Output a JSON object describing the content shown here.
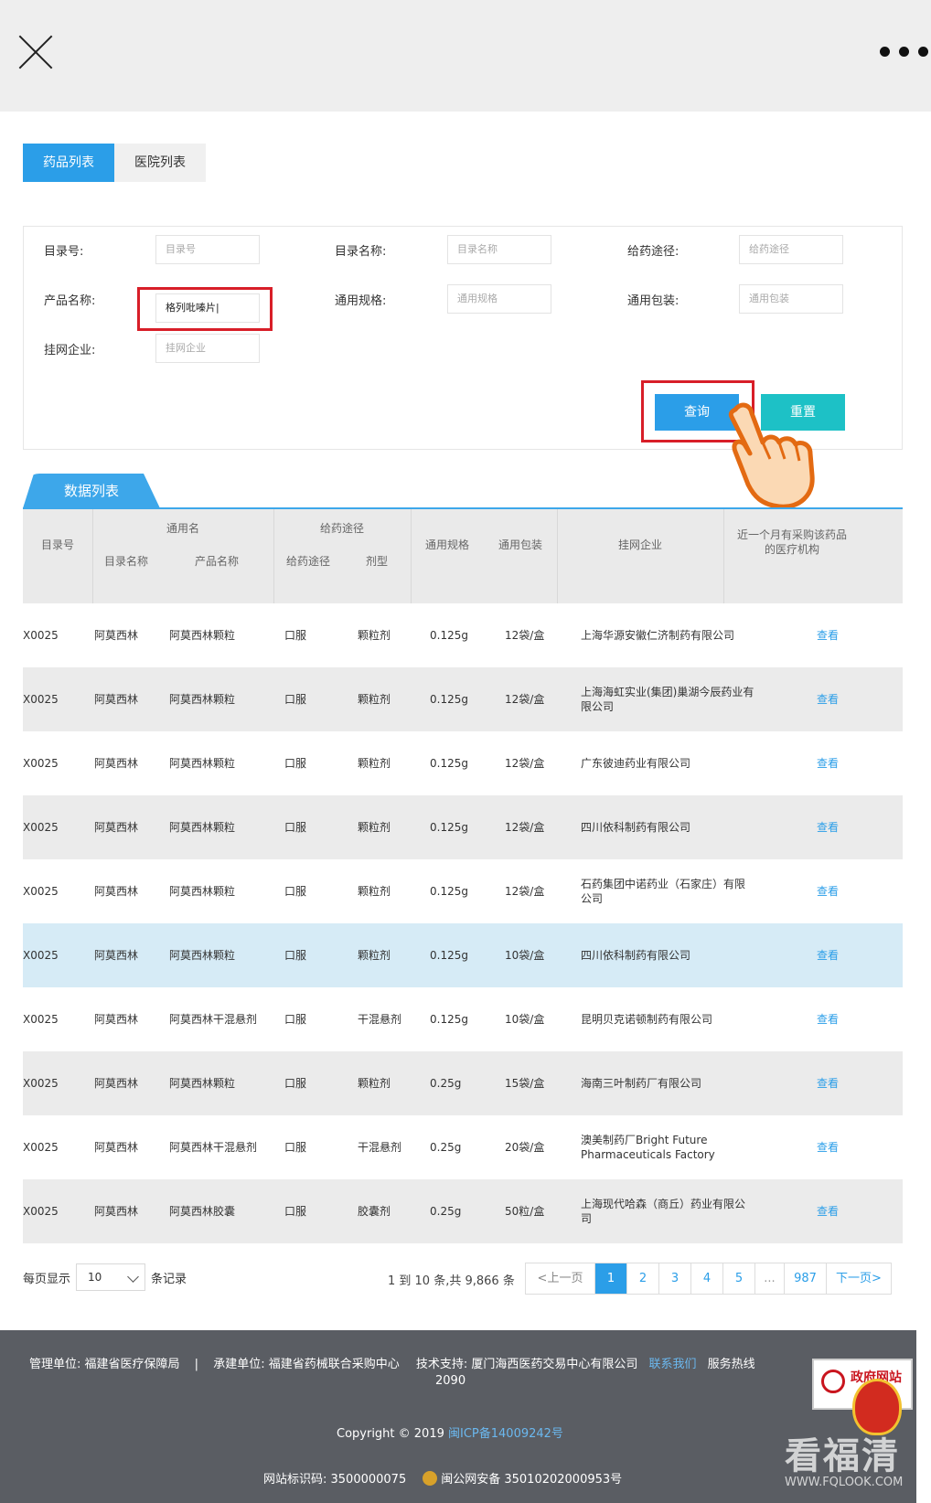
{
  "tabs": [
    {
      "label": "药品列表"
    },
    {
      "label": "医院列表"
    }
  ],
  "filter": {
    "catalog_no": {
      "label": "目录号:",
      "placeholder": "目录号"
    },
    "catalog_name": {
      "label": "目录名称:",
      "placeholder": "目录名称"
    },
    "route": {
      "label": "给药途径:",
      "placeholder": "给药途径"
    },
    "product_name": {
      "label": "产品名称:",
      "value": "格列吡嗪片|"
    },
    "spec": {
      "label": "通用规格:",
      "placeholder": "通用规格"
    },
    "package": {
      "label": "通用包装:",
      "placeholder": "通用包装"
    },
    "company": {
      "label": "挂网企业:",
      "placeholder": "挂网企业"
    },
    "query_label": "查询",
    "reset_label": "重置"
  },
  "data_list_tab": "数据列表",
  "table_header": {
    "catalog_no": "目录号",
    "generic_name": "通用名",
    "catalog_name": "目录名称",
    "product_name": "产品名称",
    "route_group": "给药途径",
    "route": "给药途径",
    "form": "剂型",
    "spec": "通用规格",
    "package": "通用包装",
    "company": "挂网企业",
    "hospitals": "近一个月有采购该药品的医疗机构"
  },
  "rows": [
    {
      "no": "X0025",
      "cname": "阿莫西林",
      "pname": "阿莫西林颗粒",
      "route": "口服",
      "form": "颗粒剂",
      "spec": "0.125g",
      "pkg": "12袋/盒",
      "company": "上海华源安徽仁济制药有限公司",
      "action": "查看"
    },
    {
      "no": "X0025",
      "cname": "阿莫西林",
      "pname": "阿莫西林颗粒",
      "route": "口服",
      "form": "颗粒剂",
      "spec": "0.125g",
      "pkg": "12袋/盒",
      "company": "上海海虹实业(集团)巢湖今辰药业有限公司",
      "action": "查看"
    },
    {
      "no": "X0025",
      "cname": "阿莫西林",
      "pname": "阿莫西林颗粒",
      "route": "口服",
      "form": "颗粒剂",
      "spec": "0.125g",
      "pkg": "12袋/盒",
      "company": "广东彼迪药业有限公司",
      "action": "查看"
    },
    {
      "no": "X0025",
      "cname": "阿莫西林",
      "pname": "阿莫西林颗粒",
      "route": "口服",
      "form": "颗粒剂",
      "spec": "0.125g",
      "pkg": "12袋/盒",
      "company": "四川依科制药有限公司",
      "action": "查看"
    },
    {
      "no": "X0025",
      "cname": "阿莫西林",
      "pname": "阿莫西林颗粒",
      "route": "口服",
      "form": "颗粒剂",
      "spec": "0.125g",
      "pkg": "12袋/盒",
      "company": "石药集团中诺药业（石家庄）有限公司",
      "action": "查看"
    },
    {
      "no": "X0025",
      "cname": "阿莫西林",
      "pname": "阿莫西林颗粒",
      "route": "口服",
      "form": "颗粒剂",
      "spec": "0.125g",
      "pkg": "10袋/盒",
      "company": "四川依科制药有限公司",
      "action": "查看"
    },
    {
      "no": "X0025",
      "cname": "阿莫西林",
      "pname": "阿莫西林干混悬剂",
      "route": "口服",
      "form": "干混悬剂",
      "spec": "0.125g",
      "pkg": "10袋/盒",
      "company": "昆明贝克诺顿制药有限公司",
      "action": "查看"
    },
    {
      "no": "X0025",
      "cname": "阿莫西林",
      "pname": "阿莫西林颗粒",
      "route": "口服",
      "form": "颗粒剂",
      "spec": "0.25g",
      "pkg": "15袋/盒",
      "company": "海南三叶制药厂有限公司",
      "action": "查看"
    },
    {
      "no": "X0025",
      "cname": "阿莫西林",
      "pname": "阿莫西林干混悬剂",
      "route": "口服",
      "form": "干混悬剂",
      "spec": "0.25g",
      "pkg": "20袋/盒",
      "company": "澳美制药厂Bright Future Pharmaceuticals Factory",
      "action": "查看"
    },
    {
      "no": "X0025",
      "cname": "阿莫西林",
      "pname": "阿莫西林胶囊",
      "route": "口服",
      "form": "胶囊剂",
      "spec": "0.25g",
      "pkg": "50粒/盒",
      "company": "上海现代哈森（商丘）药业有限公司",
      "action": "查看"
    }
  ],
  "pagination": {
    "per_page_label": "每页显示",
    "per_page_value": "10",
    "records_label": "条记录",
    "summary": "1 到 10 条,共 9,866 条",
    "prev": "<上一页",
    "pages": [
      "1",
      "2",
      "3",
      "4",
      "5"
    ],
    "ellipsis": "...",
    "last": "987",
    "next": "下一页>"
  },
  "footer": {
    "manager": "管理单位: 福建省医疗保障局",
    "sep": "|",
    "builder": "承建单位: 福建省药械联合采购中心",
    "tech": "技术支持: 厦门海西医药交易中心有限公司",
    "contact": "联系我们",
    "hotline": "服务热线",
    "hotline_num": "2090",
    "copyright": "Copyright © 2019",
    "icp": "闽ICP备14009242号",
    "site_id": "网站标识码: 3500000075",
    "police": "闽公网安备 35010202000953号"
  },
  "gov_seal_text": "政府网站",
  "watermark": {
    "big": "看福清",
    "small": "WWW.FQLOOK.COM"
  },
  "colors": {
    "primary": "#2b9ee8",
    "reset": "#1dc1c6",
    "highlight": "#d81e28",
    "footer_bg": "#5a5d63"
  }
}
